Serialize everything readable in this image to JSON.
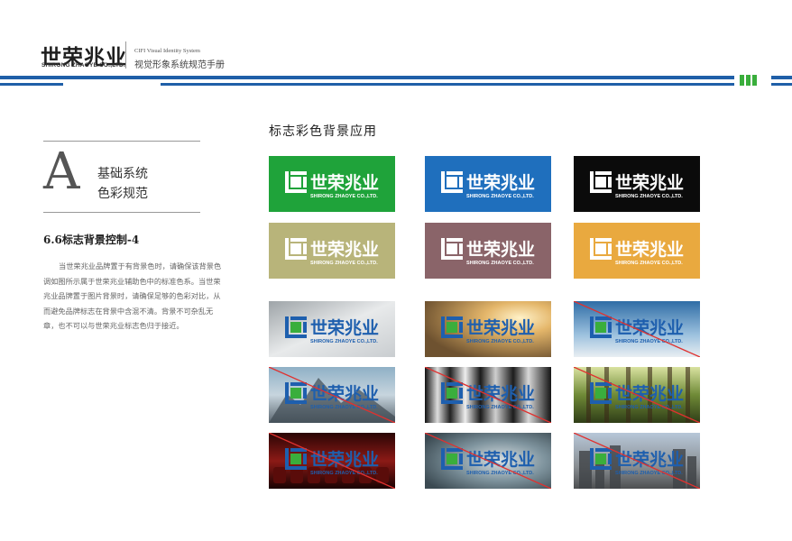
{
  "header": {
    "brand_cn": "世荣兆业",
    "brand_en": "SHIRONG ZHAOYE CO.,LTD.",
    "vis_en": "CIFI Visual Identity System",
    "vis_cn": "视觉形象系统规范手册"
  },
  "section": {
    "letter": "A",
    "line1": "基础系统",
    "line2": "色彩规范",
    "subtitle": "6.6标志背景控制-4",
    "body": "当世荣兆业品牌置于有背景色时，请确保该背景色调如图所示属于世荣兆业辅助色中的标准色系。当世荣兆业品牌置于图片背景时，请确保足够的色彩对比，从而避免品牌标志在背景中含混不清。背景不可杂乱无章，也不可以与世荣兆业标志色归于接近。"
  },
  "main": {
    "title": "标志彩色背景应用"
  },
  "logo": {
    "cn": "世荣兆业",
    "en": "SHIRONG ZHAOYE CO.,LTD."
  },
  "tiles": [
    {
      "bg": "#1fa33a",
      "type": "solid",
      "logo": "white",
      "valid": true
    },
    {
      "bg": "#1f6fbd",
      "type": "solid",
      "logo": "white",
      "valid": true
    },
    {
      "bg": "#0b0b0b",
      "type": "solid",
      "logo": "white",
      "valid": true
    },
    {
      "bg": "#b8b47a",
      "type": "solid",
      "logo": "white",
      "valid": true
    },
    {
      "bg": "#8a6469",
      "type": "solid",
      "logo": "white",
      "valid": true
    },
    {
      "bg": "#e9a93f",
      "type": "solid",
      "logo": "white",
      "valid": true
    },
    {
      "bg": "photo-snow",
      "type": "photo",
      "logo": "color",
      "valid": true
    },
    {
      "bg": "photo-sunset",
      "type": "photo",
      "logo": "color",
      "valid": true
    },
    {
      "bg": "photo-sky",
      "type": "photo",
      "logo": "color",
      "valid": false
    },
    {
      "bg": "photo-mountain",
      "type": "photo",
      "logo": "color",
      "valid": false
    },
    {
      "bg": "photo-metal",
      "type": "photo",
      "logo": "color",
      "valid": false
    },
    {
      "bg": "photo-forest",
      "type": "photo",
      "logo": "color",
      "valid": false
    },
    {
      "bg": "photo-theater",
      "type": "photo",
      "logo": "color",
      "valid": false
    },
    {
      "bg": "photo-water",
      "type": "photo",
      "logo": "color",
      "valid": false
    },
    {
      "bg": "photo-city",
      "type": "photo",
      "logo": "color",
      "valid": false
    }
  ],
  "colors": {
    "brand_blue": "#1f5fa8",
    "brand_green": "#3aae3c",
    "strike_red": "#e0312f"
  }
}
